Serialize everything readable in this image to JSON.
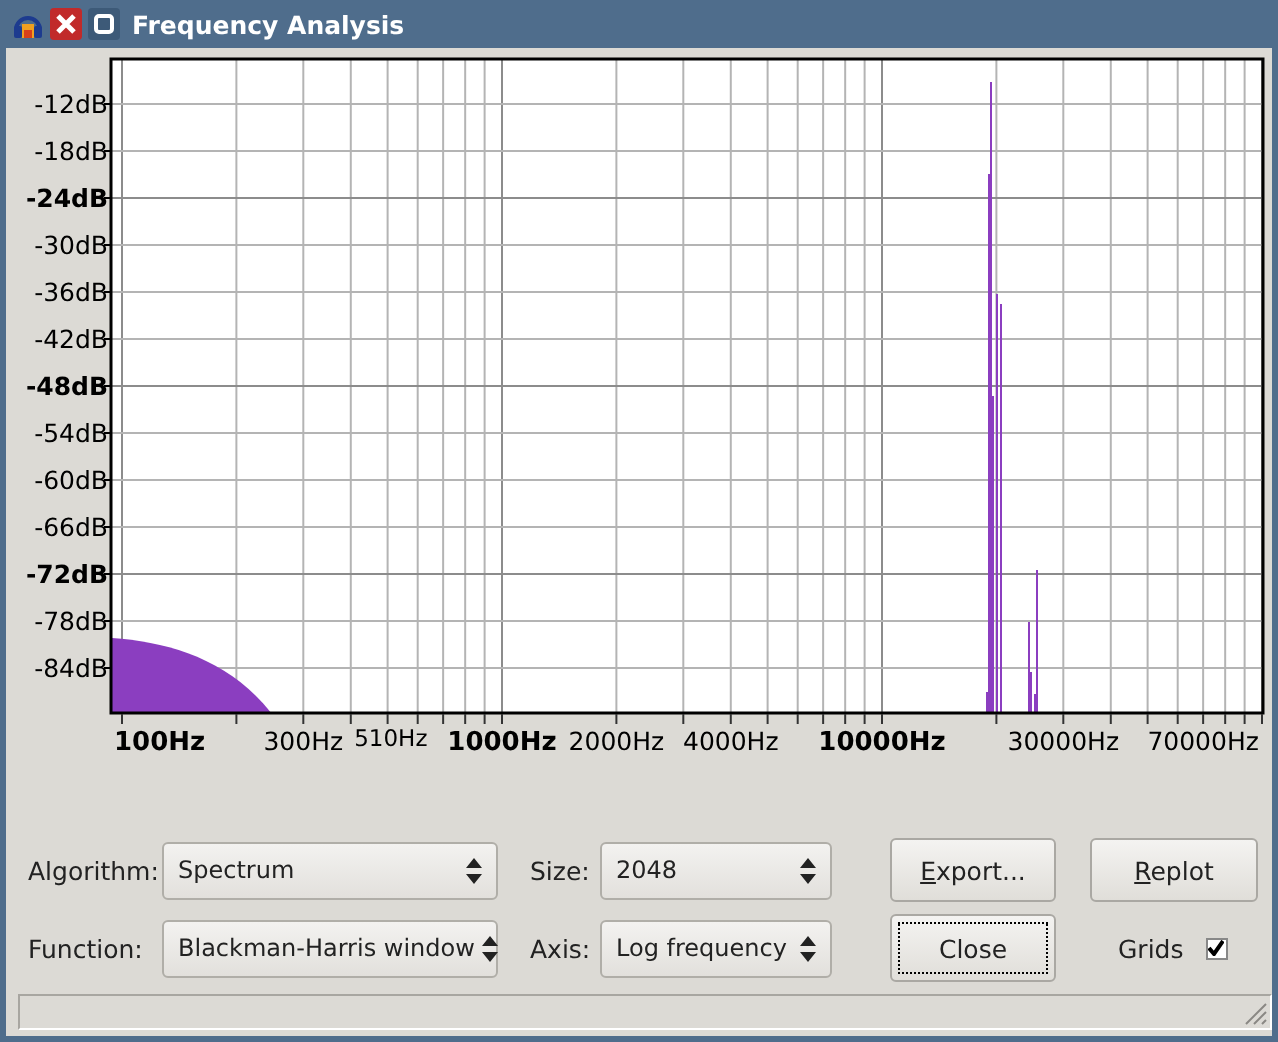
{
  "window": {
    "title": "Frequency Analysis"
  },
  "plot": {
    "y_ticks": [
      {
        "label": "-12dB",
        "kind": "minor"
      },
      {
        "label": "-18dB",
        "kind": "minor"
      },
      {
        "label": "-24dB",
        "kind": "major"
      },
      {
        "label": "-30dB",
        "kind": "minor"
      },
      {
        "label": "-36dB",
        "kind": "minor"
      },
      {
        "label": "-42dB",
        "kind": "minor"
      },
      {
        "label": "-48dB",
        "kind": "major"
      },
      {
        "label": "-54dB",
        "kind": "minor"
      },
      {
        "label": "-60dB",
        "kind": "minor"
      },
      {
        "label": "-66dB",
        "kind": "minor"
      },
      {
        "label": "-72dB",
        "kind": "major"
      },
      {
        "label": "-78dB",
        "kind": "minor"
      },
      {
        "label": "-84dB",
        "kind": "minor"
      }
    ],
    "x_ticks": [
      {
        "label": "100Hz",
        "kind": "major"
      },
      {
        "label": "300Hz",
        "kind": "minor"
      },
      {
        "label": "510Hz",
        "kind": "compact"
      },
      {
        "label": "1000Hz",
        "kind": "major"
      },
      {
        "label": "2000Hz",
        "kind": "minor"
      },
      {
        "label": "4000Hz",
        "kind": "minor"
      },
      {
        "label": "10000Hz",
        "kind": "major"
      },
      {
        "label": "30000Hz",
        "kind": "minor"
      },
      {
        "label": "70000Hz",
        "kind": "minor"
      }
    ]
  },
  "controls": [
    {
      "label": "Algorithm:",
      "value": "Spectrum"
    },
    {
      "label": "Size:",
      "value": "2048"
    },
    {
      "label": "Function:",
      "value": "Blackman-Harris window"
    },
    {
      "label": "Axis:",
      "value": "Log frequency"
    }
  ],
  "buttons": [
    {
      "label": "Export...",
      "mnemonic_underlined": true,
      "focused": false
    },
    {
      "label": "Replot",
      "mnemonic_underlined": true,
      "focused": false
    },
    {
      "label": "Close",
      "mnemonic_underlined": false,
      "focused": true
    }
  ],
  "grids": {
    "label": "Grids",
    "checked": true
  }
}
